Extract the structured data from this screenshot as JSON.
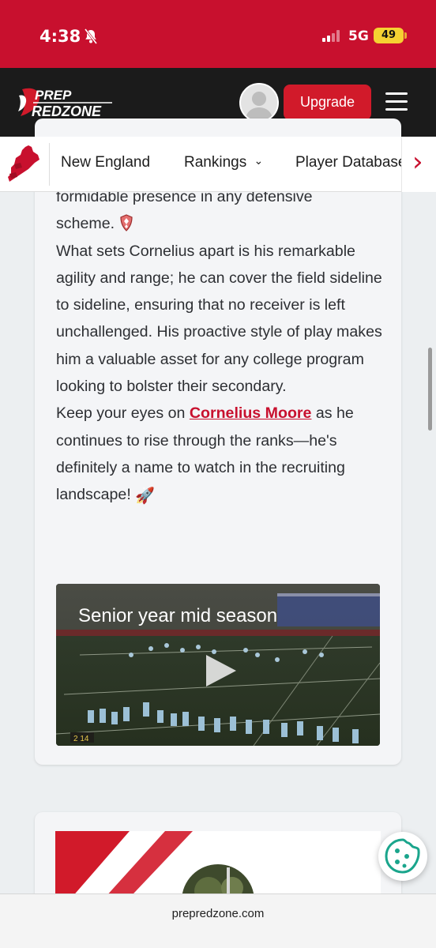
{
  "status_bar": {
    "time": "4:38",
    "network": "5G",
    "battery": "49",
    "colors": {
      "background": "#c8102e",
      "battery": "#f5d132"
    }
  },
  "header": {
    "logo_line1": "PREP",
    "logo_line2": "REDZONE",
    "upgrade_label": "Upgrade",
    "colors": {
      "background": "#1b1b1b",
      "accent": "#d11a2a"
    }
  },
  "subnav": {
    "region": "New England",
    "rankings": "Rankings",
    "rankings_chevron": "⌄",
    "player_database": "Player Database",
    "next_arrow": "›"
  },
  "article": {
    "partial_line": "formidable presence in any defensive",
    "scheme_word": "scheme.",
    "paragraph2": "What sets Cornelius apart is his remarkable agility and range; he can cover the field sideline to sideline, ensuring that no receiver is left unchallenged. His proactive style of play makes him a valuable asset for any college program looking to bolster their secondary.",
    "p3_before": "Keep your eyes on ",
    "player_link": "Cornelius Moore",
    "p3_after": " as he continues to rise through the ranks—he's definitely a name to watch in the recruiting landscape!",
    "rocket_emoji": "🚀"
  },
  "video": {
    "title": "Senior year mid season",
    "scoreboard": "2 14"
  },
  "footer": {
    "url": "prepredzone.com"
  },
  "icons": [
    "bell-mute-icon",
    "signal-icon",
    "battery-icon",
    "avatar-placeholder-icon",
    "hamburger-menu-icon",
    "new-england-map-icon",
    "chevron-down-icon",
    "chevron-right-icon",
    "shield-emoji-icon",
    "rocket-emoji-icon",
    "play-icon",
    "cookie-icon"
  ]
}
